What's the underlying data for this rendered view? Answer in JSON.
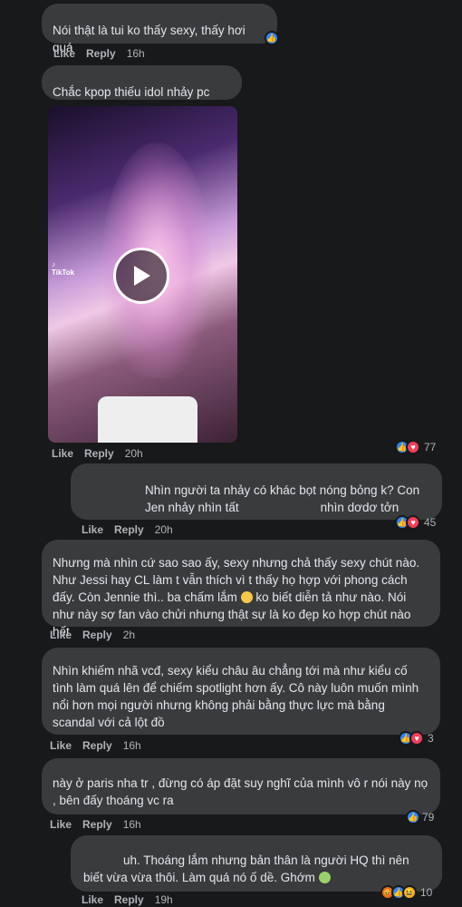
{
  "actions": {
    "like": "Like",
    "reply": "Reply"
  },
  "comments": [
    {
      "text": "Nói thật là tui ko thấy sexy, thấy hơi quá",
      "time": "16h"
    },
    {
      "text": "Chắc kpop thiếu idol nhảy pc sexy",
      "time": "20h",
      "video": {
        "brand": "TikTok"
      },
      "reactions": {
        "count": "77"
      }
    },
    {
      "text": "Nhìn người ta nhảy có khác bọt nóng bỏng k? Con Jen nhảy nhìn tất                        nhìn dơdơ tởn",
      "time": "20h",
      "reactions": {
        "count": "45"
      }
    },
    {
      "text": "Nhưng mà nhìn cứ sao sao ấy, sexy nhưng chả thấy sexy chút nào. Như Jessi hay CL làm t vẫn thích vì t thấy họ hợp với phong cách đấy. Còn Jennie thì.. ba chấm lắm",
      "text2": " ko biết diễn tả như nào. Nói như này sợ fan vào chửi nhưng thật sự là ko đẹp ko hợp chút nào hết",
      "time": "2h"
    },
    {
      "text": "Nhìn khiếm nhã vcđ, sexy kiểu châu âu chẳng tới mà như kiểu cố tình làm quá lên để chiếm spotlight hơn ấy. Cô này luôn muốn mình nổi hơn mọi người nhưng không phải bằng thực lực mà bằng scandal với cả lột đồ",
      "time": "16h",
      "reactions": {
        "count": "3"
      }
    },
    {
      "text": "này ở paris nha tr , đừng có áp đặt suy nghĩ của mình vô r nói này nọ , bên đấy thoáng vc ra",
      "time": "16h",
      "reactions": {
        "count": "79"
      }
    },
    {
      "text": "uh. Thoáng lắm nhưng bản thân là người HQ thì nên biết vừa vừa thôi. Làm quá nó ố dề. Ghớm",
      "time": "19h",
      "reactions": {
        "count": "10"
      }
    }
  ]
}
